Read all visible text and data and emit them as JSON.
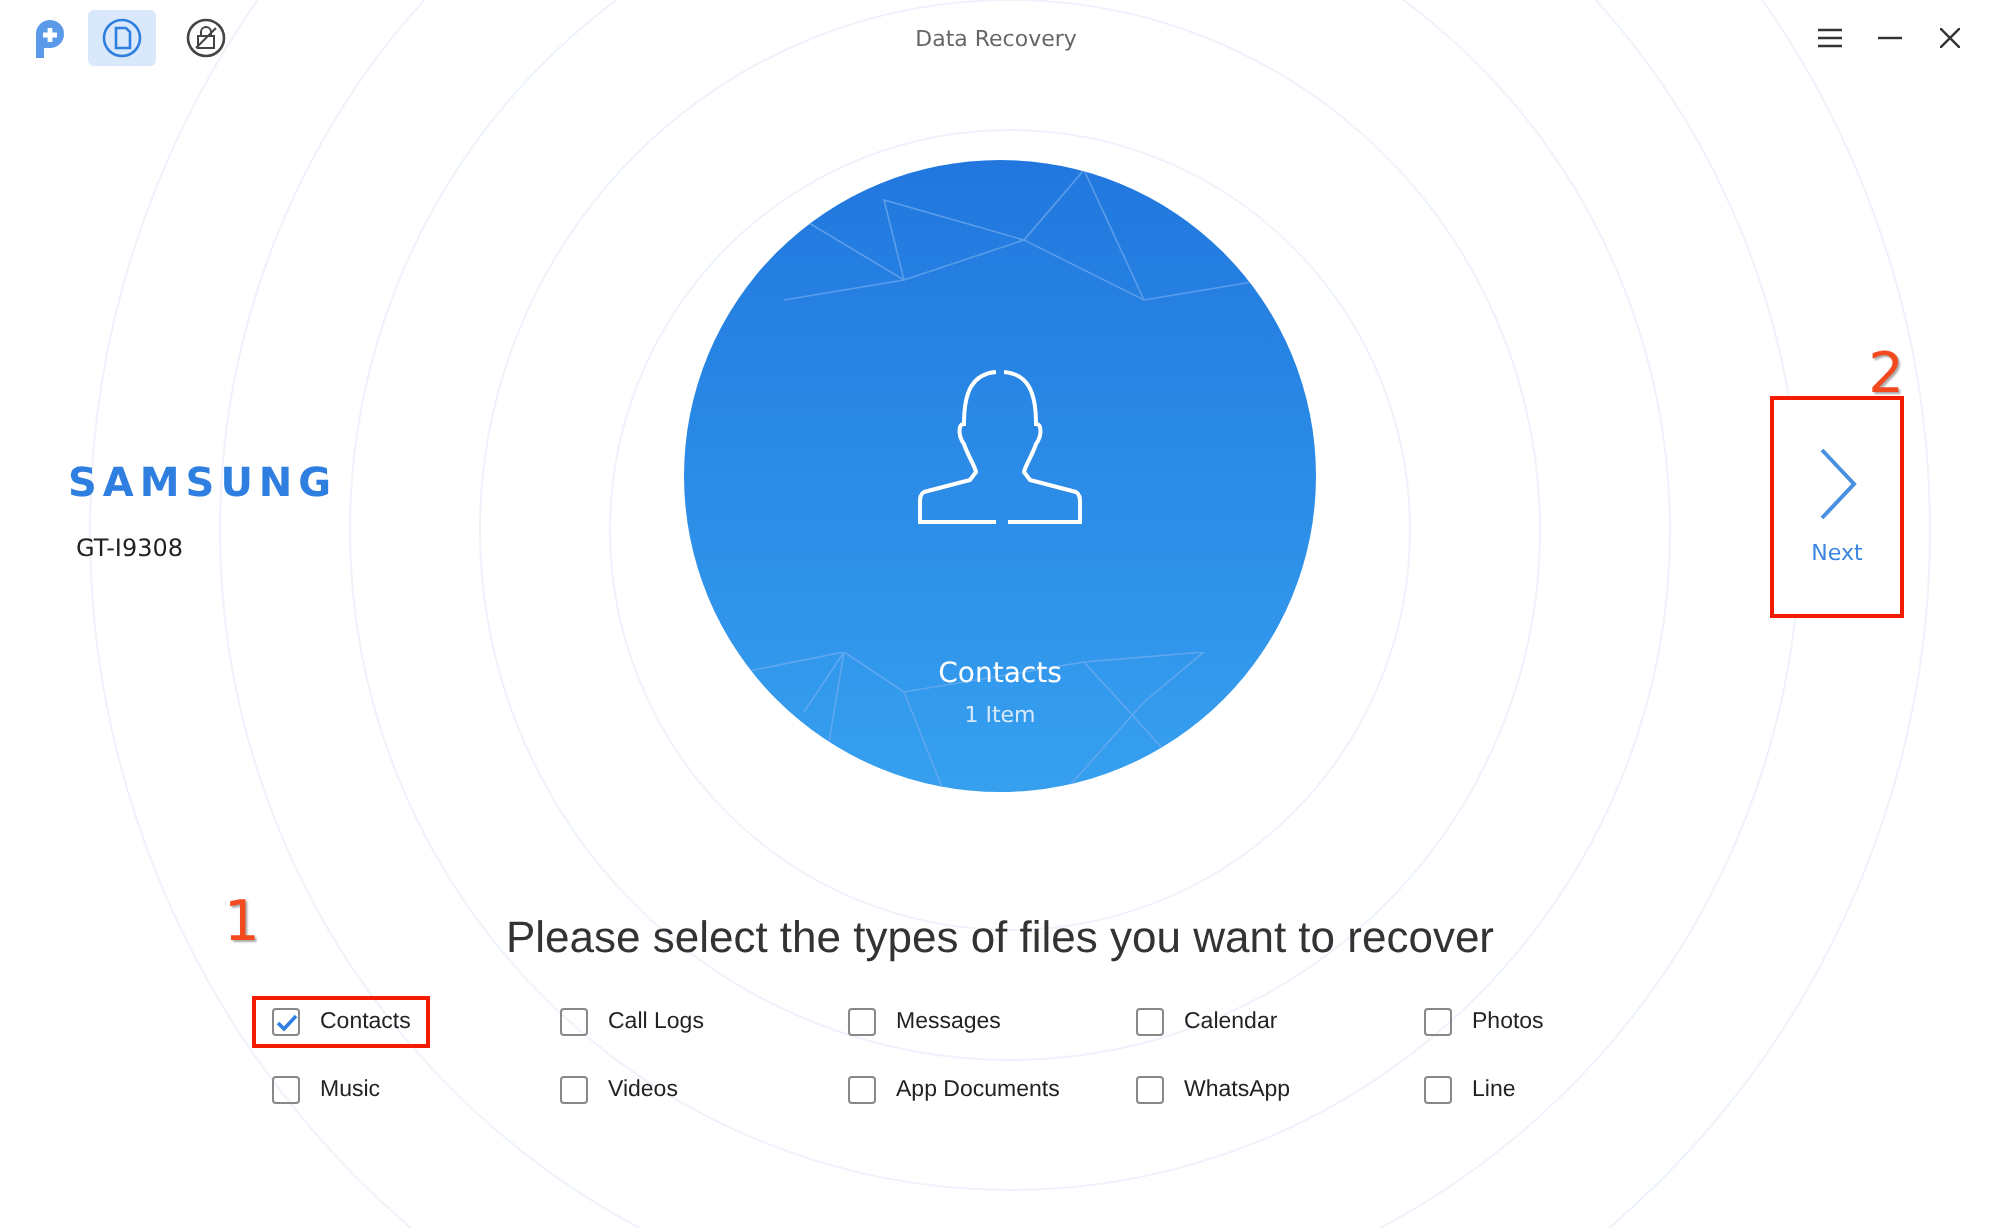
{
  "window": {
    "title": "Data Recovery"
  },
  "toolbar": [
    {
      "kind": "recover",
      "selected": true
    },
    {
      "kind": "unlock",
      "selected": false
    }
  ],
  "device": {
    "brand": "SAMSUNG",
    "model": "GT-I9308"
  },
  "preview": {
    "label": "Contacts",
    "count": "1 Item"
  },
  "next_button": {
    "label": "Next",
    "highlighted": true,
    "marker": "2"
  },
  "prompt": {
    "text": "Please select the types of files you want to recover",
    "marker": "1"
  },
  "file_types": [
    {
      "label": "Contacts",
      "checked": true,
      "highlighted": true
    },
    {
      "label": "Call Logs",
      "checked": false,
      "highlighted": false
    },
    {
      "label": "Messages",
      "checked": false,
      "highlighted": false
    },
    {
      "label": "Calendar",
      "checked": false,
      "highlighted": false
    },
    {
      "label": "Photos",
      "checked": false,
      "highlighted": false
    },
    {
      "label": "Music",
      "checked": false,
      "highlighted": false
    },
    {
      "label": "Videos",
      "checked": false,
      "highlighted": false
    },
    {
      "label": "App Documents",
      "checked": false,
      "highlighted": false
    },
    {
      "label": "WhatsApp",
      "checked": false,
      "highlighted": false
    },
    {
      "label": "Line",
      "checked": false,
      "highlighted": false
    }
  ]
}
